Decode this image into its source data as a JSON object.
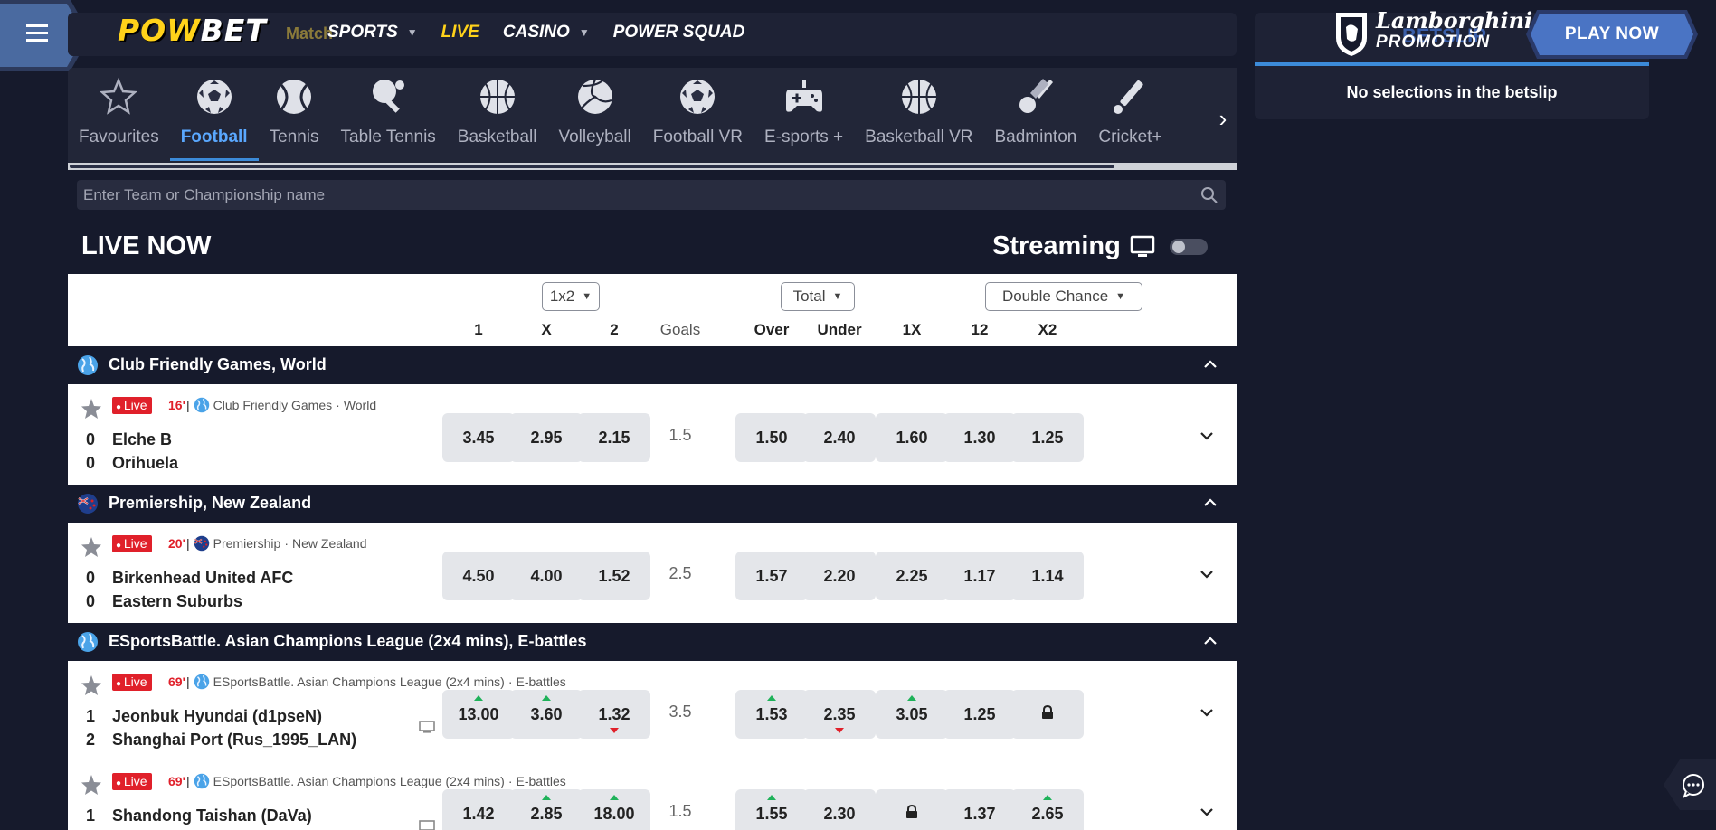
{
  "brand": {
    "logo_a": "POW",
    "logo_b": "BET",
    "matchcenter": "Match"
  },
  "topnav": [
    {
      "label": "SPORTS",
      "has_caret": true
    },
    {
      "label": "LIVE",
      "has_caret": false
    },
    {
      "label": "CASINO",
      "has_caret": true
    },
    {
      "label": "POWER SQUAD",
      "has_caret": false
    }
  ],
  "betslip": {
    "title": "BETSLIP",
    "empty_text": "No selections in the betslip"
  },
  "promo": {
    "brand": "Lamborghini",
    "label": "PROMOTION",
    "button": "PLAY NOW"
  },
  "sports": [
    {
      "label": "Favourites",
      "icon": "star-icon"
    },
    {
      "label": "Football",
      "icon": "football-icon",
      "active": true
    },
    {
      "label": "Tennis",
      "icon": "tennis-icon"
    },
    {
      "label": "Table Tennis",
      "icon": "table-tennis-icon"
    },
    {
      "label": "Basketball",
      "icon": "basketball-icon"
    },
    {
      "label": "Volleyball",
      "icon": "volleyball-icon"
    },
    {
      "label": "Football VR",
      "icon": "football-vr-icon"
    },
    {
      "label": "E-sports +",
      "icon": "gamepad-icon"
    },
    {
      "label": "Basketball VR",
      "icon": "basketball-vr-icon"
    },
    {
      "label": "Badminton",
      "icon": "shuttlecock-icon"
    },
    {
      "label": "Cricket+",
      "icon": "cricket-icon"
    }
  ],
  "search": {
    "placeholder": "Enter Team or Championship name"
  },
  "live": {
    "title": "LIVE NOW",
    "streaming_label": "Streaming",
    "streaming_on": false
  },
  "markets": {
    "dropdowns": [
      "1x2",
      "Total",
      "Double Chance"
    ],
    "columns": [
      "1",
      "X",
      "2",
      "Goals",
      "Over",
      "Under",
      "1X",
      "12",
      "X2"
    ]
  },
  "leagues": [
    {
      "name": "Club Friendly Games, World",
      "flag": "globe-icon",
      "matches": [
        {
          "live_label": "Live",
          "minute": "16'",
          "competition": "Club Friendly Games",
          "region": "World",
          "home": {
            "score": "0",
            "team": "Elche B"
          },
          "away": {
            "score": "0",
            "team": "Orihuela"
          },
          "has_tv": false,
          "odds": [
            {
              "v": "3.45"
            },
            {
              "v": "2.95"
            },
            {
              "v": "2.15"
            },
            {
              "v": "1.5",
              "goals": true
            },
            {
              "v": "1.50"
            },
            {
              "v": "2.40"
            },
            {
              "v": "1.60"
            },
            {
              "v": "1.30"
            },
            {
              "v": "1.25"
            }
          ]
        }
      ]
    },
    {
      "name": "Premiership, New Zealand",
      "flag": "new-zealand-flag-icon",
      "matches": [
        {
          "live_label": "Live",
          "minute": "20'",
          "competition": "Premiership",
          "region": "New Zealand",
          "home": {
            "score": "0",
            "team": "Birkenhead United AFC"
          },
          "away": {
            "score": "0",
            "team": "Eastern Suburbs"
          },
          "has_tv": false,
          "odds": [
            {
              "v": "4.50"
            },
            {
              "v": "4.00"
            },
            {
              "v": "1.52"
            },
            {
              "v": "2.5",
              "goals": true
            },
            {
              "v": "1.57"
            },
            {
              "v": "2.20"
            },
            {
              "v": "2.25"
            },
            {
              "v": "1.17"
            },
            {
              "v": "1.14"
            }
          ]
        }
      ]
    },
    {
      "name": "ESportsBattle. Asian Champions League (2x4 mins), E-battles",
      "flag": "globe-icon",
      "matches": [
        {
          "live_label": "Live",
          "minute": "69'",
          "competition": "ESportsBattle. Asian Champions League (2x4 mins)",
          "region": "E-battles",
          "home": {
            "score": "1",
            "team": "Jeonbuk Hyundai (d1pseN)"
          },
          "away": {
            "score": "2",
            "team": "Shanghai Port (Rus_1995_LAN)"
          },
          "has_tv": true,
          "odds": [
            {
              "v": "13.00",
              "trend": "up"
            },
            {
              "v": "3.60",
              "trend": "up"
            },
            {
              "v": "1.32",
              "trend": "down"
            },
            {
              "v": "3.5",
              "goals": true
            },
            {
              "v": "1.53",
              "trend": "up"
            },
            {
              "v": "2.35",
              "trend": "down"
            },
            {
              "v": "3.05",
              "trend": "up"
            },
            {
              "v": "1.25"
            },
            {
              "v": "",
              "locked": true
            }
          ]
        },
        {
          "live_label": "Live",
          "minute": "69'",
          "competition": "ESportsBattle. Asian Champions League (2x4 mins)",
          "region": "E-battles",
          "home": {
            "score": "1",
            "team": "Shandong Taishan (DaVa)"
          },
          "away": {
            "score": "",
            "team": ""
          },
          "has_tv": true,
          "odds": [
            {
              "v": "1.42"
            },
            {
              "v": "2.85",
              "trend": "up"
            },
            {
              "v": "18.00",
              "trend": "up"
            },
            {
              "v": "1.5",
              "goals": true
            },
            {
              "v": "1.55",
              "trend": "up"
            },
            {
              "v": "2.30"
            },
            {
              "v": "",
              "locked": true
            },
            {
              "v": "1.37"
            },
            {
              "v": "2.65",
              "trend": "up"
            }
          ]
        }
      ]
    }
  ],
  "colors": {
    "accent": "#3c8bd9",
    "live_red": "#e0202a",
    "brand_yellow": "#ffd21a",
    "bg": "#161a2c"
  }
}
